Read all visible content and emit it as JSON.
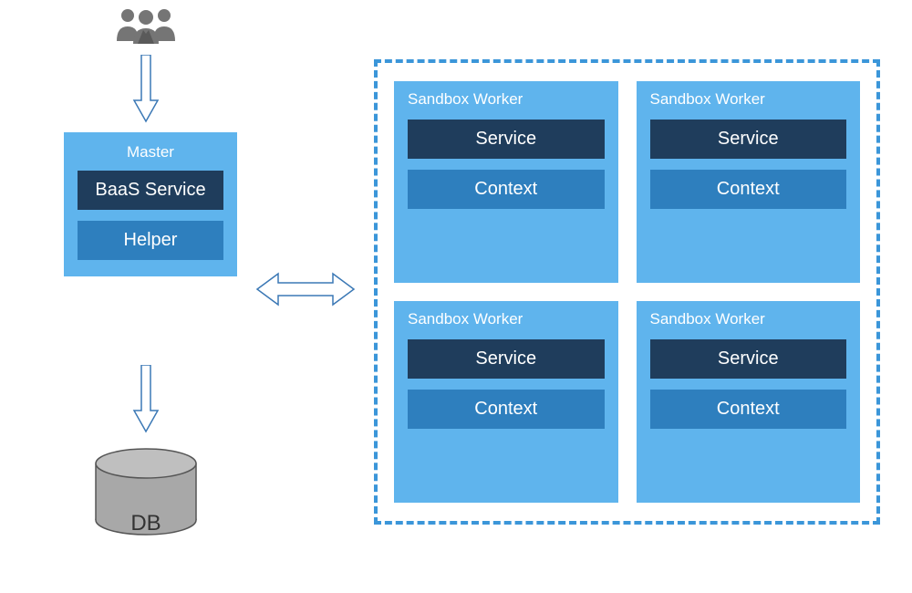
{
  "master": {
    "title": "Master",
    "service_label": "BaaS Service",
    "helper_label": "Helper"
  },
  "db": {
    "label": "DB"
  },
  "worker": {
    "title": "Sandbox Worker",
    "service_label": "Service",
    "context_label": "Context"
  },
  "colors": {
    "light_blue": "#5FB4ED",
    "dark_navy": "#1F3D5C",
    "mid_blue": "#2E7FBE",
    "dashed_border": "#3B96D9",
    "cylinder_fill": "#A8A8A8"
  }
}
